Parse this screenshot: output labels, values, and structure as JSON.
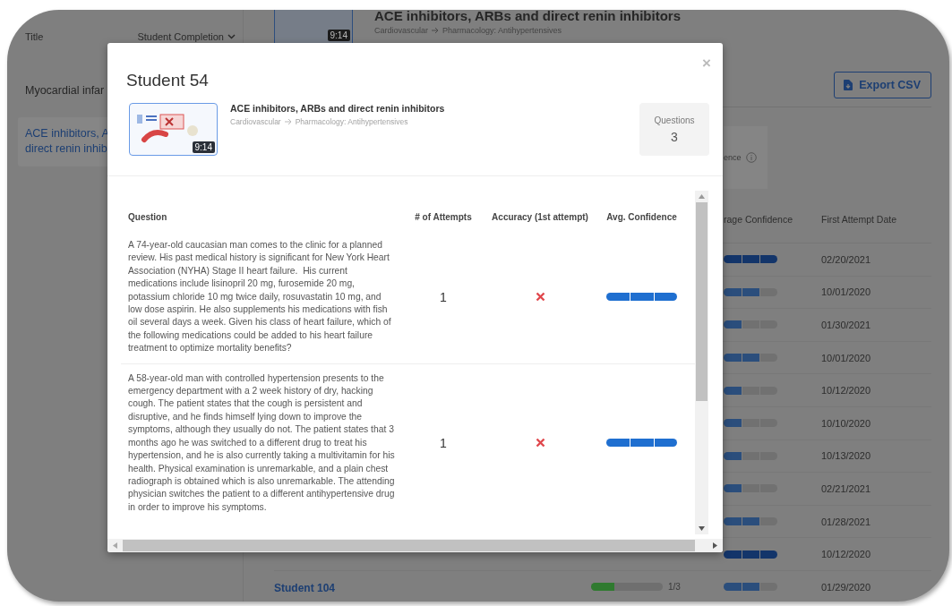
{
  "sidebar": {
    "headers": {
      "title": "Title",
      "sort": "Student Completion"
    },
    "items": [
      {
        "lines": [
          "Myocardial infar"
        ],
        "selected": false
      },
      {
        "lines": [
          "ACE inhibitors, A",
          "direct renin inhib"
        ],
        "selected": true
      }
    ]
  },
  "video": {
    "duration": "9:14",
    "title": "ACE inhibitors, ARBs and direct renin inhibitors",
    "breadcrumb": [
      "Cardiovascular",
      "Pharmacology: Antihypertensives"
    ]
  },
  "export_button": "Export CSV",
  "stat_card": {
    "label": "ence"
  },
  "table": {
    "columns": [
      "rage Confidence",
      "First Attempt Date"
    ],
    "rows": [
      {
        "confidence": {
          "level": 1
        },
        "date": "02/20/2021"
      },
      {
        "confidence": {
          "level": 0.67
        },
        "date": "10/01/2020"
      },
      {
        "confidence": {
          "level": 0.33
        },
        "date": "01/30/2021"
      },
      {
        "confidence": {
          "level": 0.67
        },
        "date": "10/01/2020"
      },
      {
        "confidence": {
          "level": 0.33
        },
        "date": "10/12/2020"
      },
      {
        "confidence": {
          "level": 0.33
        },
        "date": "10/10/2020"
      },
      {
        "confidence": {
          "level": 0.33
        },
        "date": "10/13/2020"
      },
      {
        "confidence": {
          "level": 0.33
        },
        "date": "02/21/2021"
      },
      {
        "confidence": {
          "level": 0.67
        },
        "date": "01/28/2021"
      },
      {
        "confidence": {
          "level": 1
        },
        "date": "10/12/2020"
      },
      {
        "student": "Student 104",
        "completion": {
          "level": 0.33
        },
        "completion_text": "1/3",
        "confidence": {
          "level": 0.67
        },
        "date": "01/29/2020"
      }
    ]
  },
  "modal": {
    "title": "Student 54",
    "close": "×",
    "video": {
      "duration": "9:14",
      "title": "ACE inhibitors, ARBs and direct renin inhibitors",
      "breadcrumb": [
        "Cardiovascular",
        "Pharmacology: Antihypertensives"
      ]
    },
    "stat": {
      "label": "Questions",
      "value": "3"
    },
    "columns": [
      "Question",
      "# of Attempts",
      "Accuracy (1st attempt)",
      "Avg. Confidence"
    ],
    "rows": [
      {
        "question": "A 74-year-old caucasian man comes to the clinic for a planned review. His past medical history is significant for New York Heart Association (NYHA) Stage II heart failure.  His current medications include lisinopril 20 mg, furosemide 20 mg, potassium chloride 10 mg twice daily, rosuvastatin 10 mg, and low dose aspirin. He also supplements his medications with fish oil several days a week. Given his class of heart failure, which of the following medications could be added to his heart failure treatment to optimize mortality benefits?",
        "attempts": "1",
        "correct": false,
        "confidence": {
          "level": 1
        }
      },
      {
        "question": "A 58-year-old man with controlled hypertension presents to the emergency department with a 2 week history of dry, hacking cough. The patient states that the cough is persistent and disruptive, and he finds himself lying down to improve the symptoms, although they usually do not. The patient states that 3 months ago he was switched to a different drug to treat his hypertension, and he is also currently taking a multivitamin for his health. Physical examination is unremarkable, and a plain chest radiograph is obtained which is also unremarkable. The attending physician switches the patient to a different antihypertensive drug in order to improve his symptoms.",
        "attempts": "1",
        "correct": false,
        "confidence": {
          "level": 1
        }
      }
    ]
  }
}
